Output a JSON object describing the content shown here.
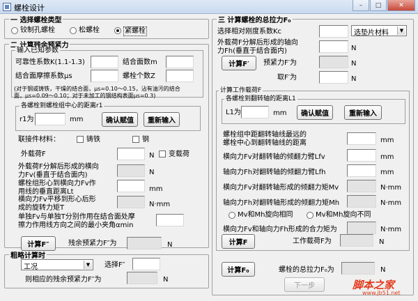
{
  "window": {
    "title": "螺栓设计",
    "minimize": "–",
    "maximize": "□",
    "close": "✕"
  },
  "bolt_type": {
    "legend": "一 选择螺栓类型",
    "options": [
      "铰制孔螺栓",
      "松螺栓",
      "紧螺栓"
    ],
    "selected": "紧螺栓"
  },
  "residual": {
    "legend": "二 计算残余预紧力",
    "known_legend": "输入已知参数",
    "kf_label": "可靠性系数K(1.1-1.3)",
    "m_label": "结合面数m",
    "mu_label": "结合面摩擦系数μs",
    "z_label": "螺栓个数Z",
    "note1": "(对于钢或铸铁，干燥的结合面，μs=0.10～0.15，沾有油污的结合",
    "note2": "面，μs=0.09～0.10；对于未加工的钢结构表面μs=0.3)",
    "dist_legend": "各螺栓到螺栓组中心的距离r1",
    "r1_label": "r1为",
    "r1_unit": "mm",
    "confirm_btn": "确认赋值",
    "reinput_btn": "重新输入",
    "material_label": "联接件材料：",
    "iron_label": "铸铁",
    "steel_label": "钢",
    "load_f_label": "外载荷F",
    "load_f_unit": "N",
    "variable_load_label": "变载荷",
    "fv_label1": "外载荷F分解后形成的横向",
    "fv_label2": "力Fv(垂直于结合面内)",
    "fv_unit": "N",
    "lt_label1": "螺栓组形心到横向力Fv作",
    "lt_label2": "用线的垂直距离Lt",
    "lt_unit": "mm",
    "t_label1": "横向力Fv平移到形心后形",
    "t_label2": "成的旋转力矩T",
    "t_unit": "N·mm",
    "amin_label1": "单独Fv与单独T分别作用在结合面处摩",
    "amin_label2": "擦力作用线方向之间的最小夹角αmin",
    "calc_btn": "计算F″",
    "result_label": "残余预紧力F″为",
    "result_unit": "N"
  },
  "rough": {
    "legend": "粗略计算时",
    "select_value": "工况",
    "choose_label": "选择F″",
    "result_label": "则相应的残余预紧力F″为",
    "result_unit": "N"
  },
  "total": {
    "legend": "三 计算螺栓的总拉力F₀",
    "kc_label": "选择相对刚度系数Kc",
    "kc_select": "选垫片材料",
    "fh_label1": "外载荷F分解后形成的轴向",
    "fh_label2": "力Fh(垂直于结合面内)",
    "fh_unit": "N",
    "calc_f1_btn": "计算F′",
    "preload_label": "预紧力F′为",
    "preload_unit": "N",
    "take_label": "取F′为",
    "take_unit": "N",
    "work_legend": "计算工作载荷F",
    "dist2_legend": "各螺栓到翻转轴的距离L1",
    "l1_label": "L1为",
    "l1_unit": "mm",
    "confirm_btn": "确认赋值",
    "reinput_btn": "重新输入",
    "farthest_label1": "螺栓组中距翻转轴线最远的",
    "farthest_label2": "螺栓中心到翻转轴线的距离",
    "farthest_unit": "mm",
    "lfv_label": "横向力Fv对翻转轴的倾翻力臂Lfv",
    "lfv_unit": "mm",
    "lfh_label": "轴向力Fh对翻转轴的倾翻力臂Lfh",
    "lfh_unit": "mm",
    "mv_label": "横向力Fv对翻转轴形成的倾翻力矩Mv",
    "mv_unit": "N·mm",
    "mh_label": "轴向力Fh对翻转轴形成的倾翻力矩Mh",
    "mh_unit": "N·mm",
    "same_dir": "Mv和Mh旋向相同",
    "diff_dir": "Mv和Mh旋向不同",
    "m_combined_label": "横向力Fv和轴向力Fh形成的合力矩为",
    "m_combined_unit": "N·mm",
    "calc_f_btn": "计算F",
    "work_f_label": "工作载荷F为",
    "work_f_unit": "N",
    "calc_f0_btn": "计算F₀",
    "f0_label": "螺栓的总拉力F₀为",
    "f0_unit": "N",
    "next_btn": "下一步"
  },
  "watermark": {
    "brand": "脚本之家",
    "url": "www.jb51.net"
  }
}
